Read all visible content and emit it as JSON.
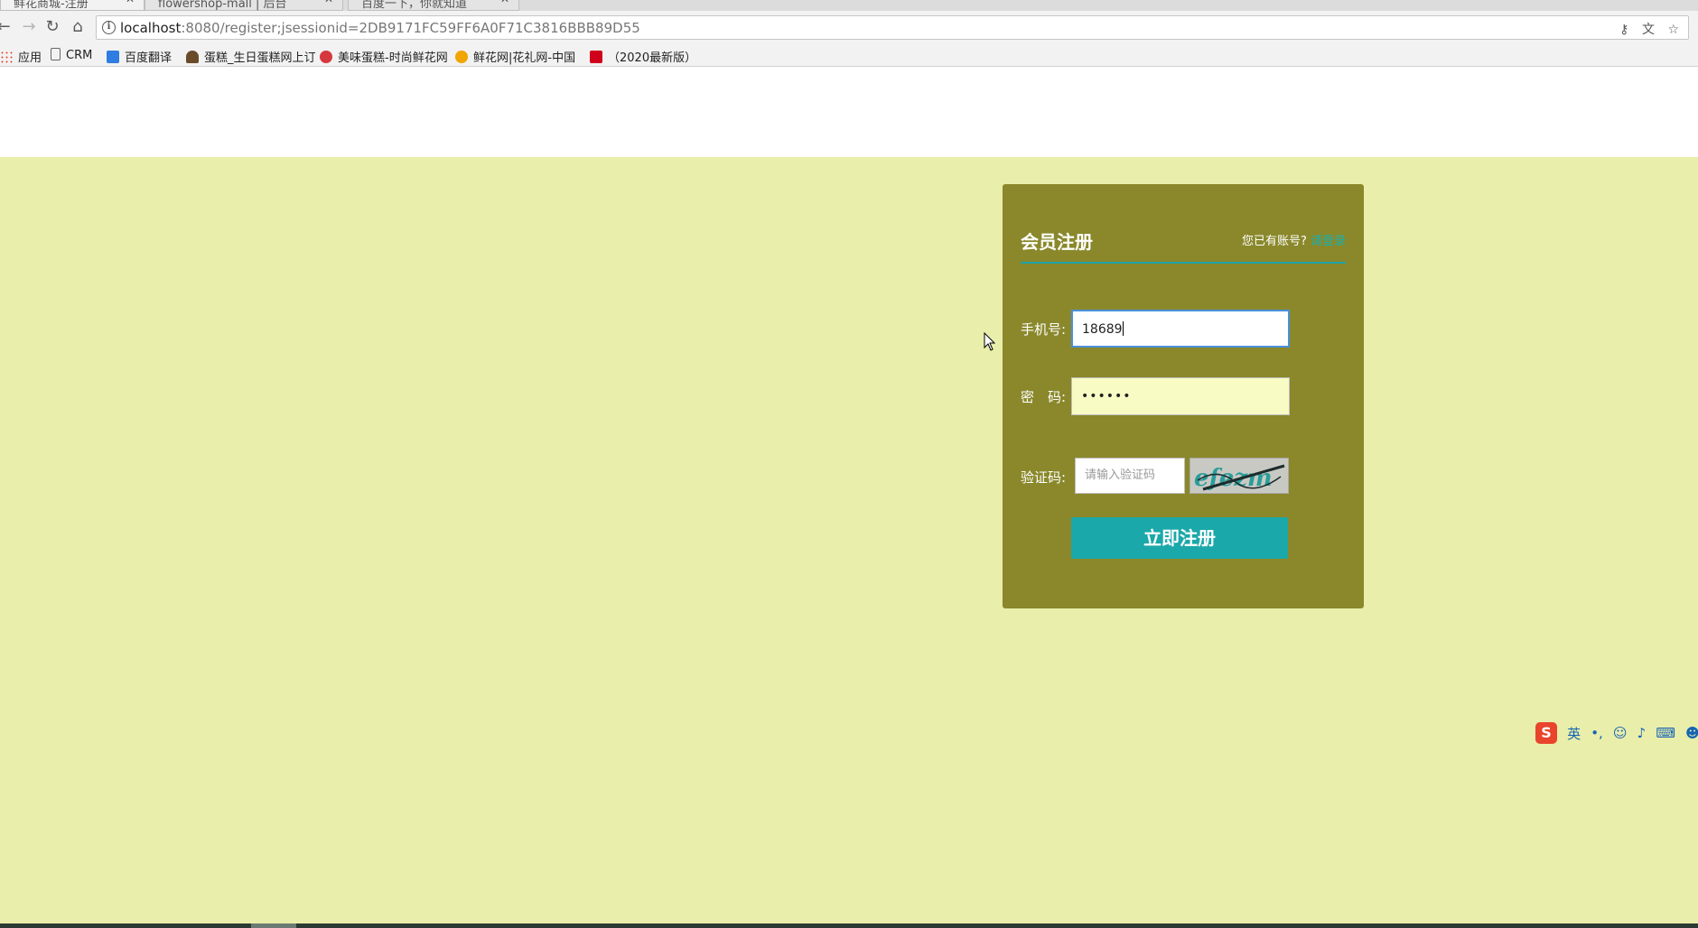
{
  "browser": {
    "tabs": [
      {
        "title": "鲜花商城-注册",
        "active": true
      },
      {
        "title": "flowershop-mall | 后台",
        "active": false
      },
      {
        "title": "百度一下，你就知道",
        "active": false
      }
    ],
    "url_host": "localhost",
    "url_rest": ":8080/register;jsessionid=2DB9171FC59FF6A0F71C3816BBB89D55",
    "bookmarks": [
      {
        "label": "应用",
        "icon": "apps-icon",
        "color": "#e8452c"
      },
      {
        "label": "CRM",
        "icon": "page-icon",
        "color": "#ffffff"
      },
      {
        "label": "百度翻译",
        "icon": "translate-icon",
        "color": "#2f7de1"
      },
      {
        "label": "蛋糕_生日蛋糕网上订",
        "icon": "cake-icon",
        "color": "#6b4a2a"
      },
      {
        "label": "美味蛋糕-时尚鲜花网",
        "icon": "flower-icon",
        "color": "#d6373f"
      },
      {
        "label": "鲜花网|花礼网-中国",
        "icon": "flower-yellow-icon",
        "color": "#f0a500"
      },
      {
        "label": "（2020最新版）",
        "icon": "c-icon",
        "color": "#d0021b"
      }
    ]
  },
  "register": {
    "title": "会员注册",
    "login_prompt": "您已有账号?",
    "login_link": "请登录",
    "phone_label": "手机号:",
    "phone_value": "18689",
    "password_label": "密　码:",
    "password_value": "••••••",
    "captcha_label": "验证码:",
    "captcha_placeholder": "请输入验证码",
    "captcha_text": "efezm",
    "submit_label": "立即注册"
  },
  "ime": {
    "logo": "S",
    "mode": "英"
  },
  "colors": {
    "page_background": "#e9eeaa",
    "panel": "#8a882b",
    "accent": "#1ba8aa"
  }
}
